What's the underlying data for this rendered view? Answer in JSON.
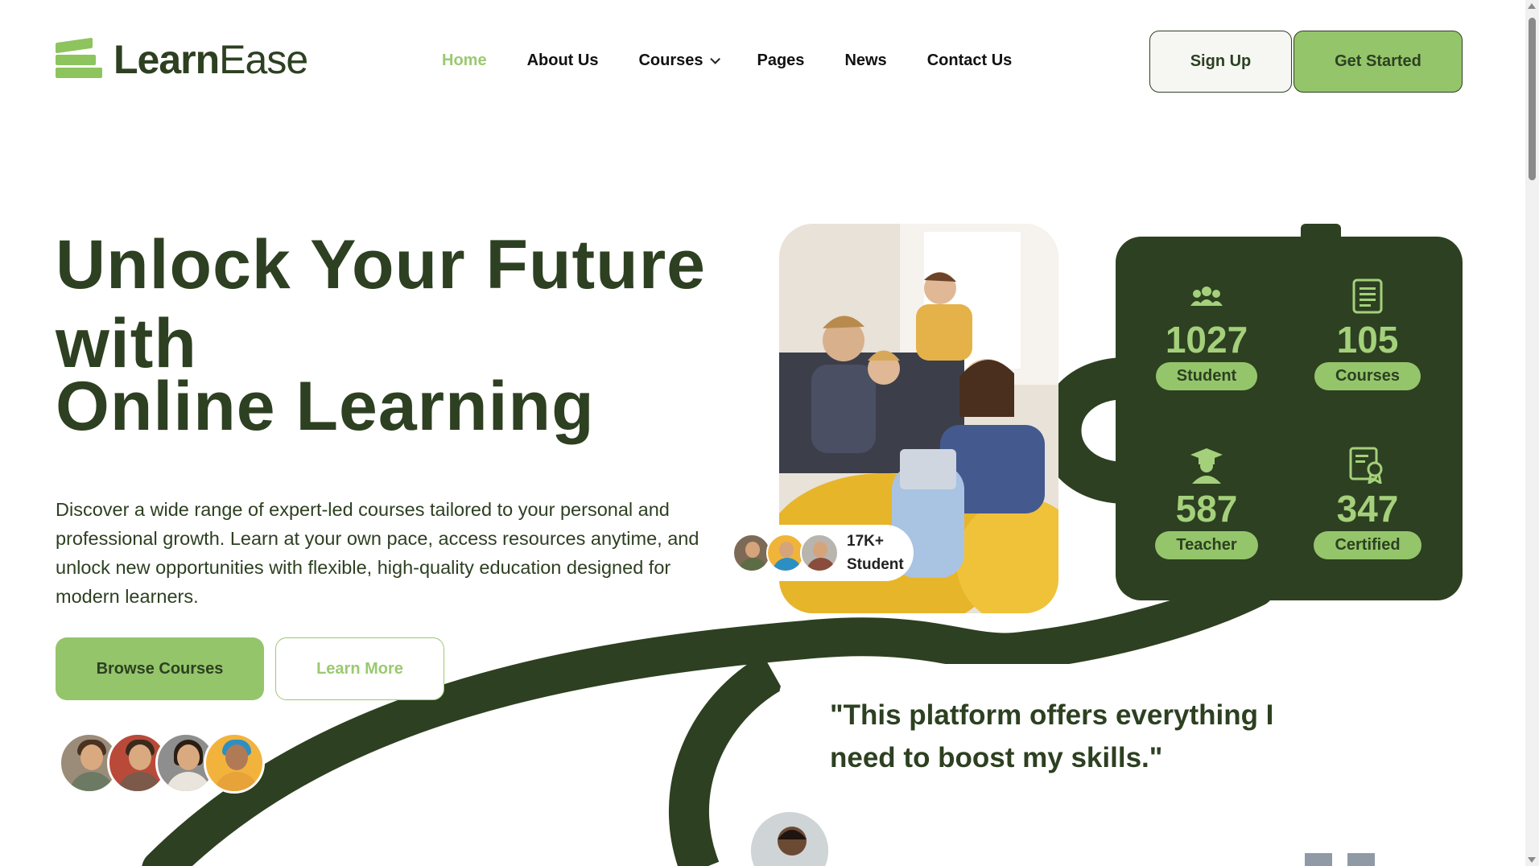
{
  "brand": {
    "name_bold": "Learn",
    "name_light": "Ease"
  },
  "nav": {
    "home": "Home",
    "about": "About Us",
    "courses": "Courses",
    "pages": "Pages",
    "news": "News",
    "contact": "Contact Us"
  },
  "header_buttons": {
    "signup": "Sign Up",
    "get_started": "Get Started"
  },
  "hero": {
    "title_line1": "Unlock Your Future",
    "title_line2": "with",
    "title_line3": "Online Learning",
    "description": "Discover a wide range of expert-led courses tailored to your personal and professional growth. Learn at your own pace, access resources anytime, and unlock new opportunities with flexible, high-quality education designed for modern learners.",
    "browse_button": "Browse Courses",
    "learn_button": "Learn More"
  },
  "student_badge": {
    "count": "17K+",
    "label": "Student"
  },
  "stats": [
    {
      "value": "1027",
      "label": "Student",
      "icon": "users-icon"
    },
    {
      "value": "105",
      "label": "Courses",
      "icon": "document-icon"
    },
    {
      "value": "587",
      "label": "Teacher",
      "icon": "graduate-icon"
    },
    {
      "value": "347",
      "label": "Certified",
      "icon": "certificate-icon"
    }
  ],
  "testimonial": {
    "quote": "\"This platform offers everything I need to boost my skills.\""
  },
  "colors": {
    "dark_green": "#2d4021",
    "light_green": "#94c56b",
    "accent_text": "#a4d07b"
  }
}
